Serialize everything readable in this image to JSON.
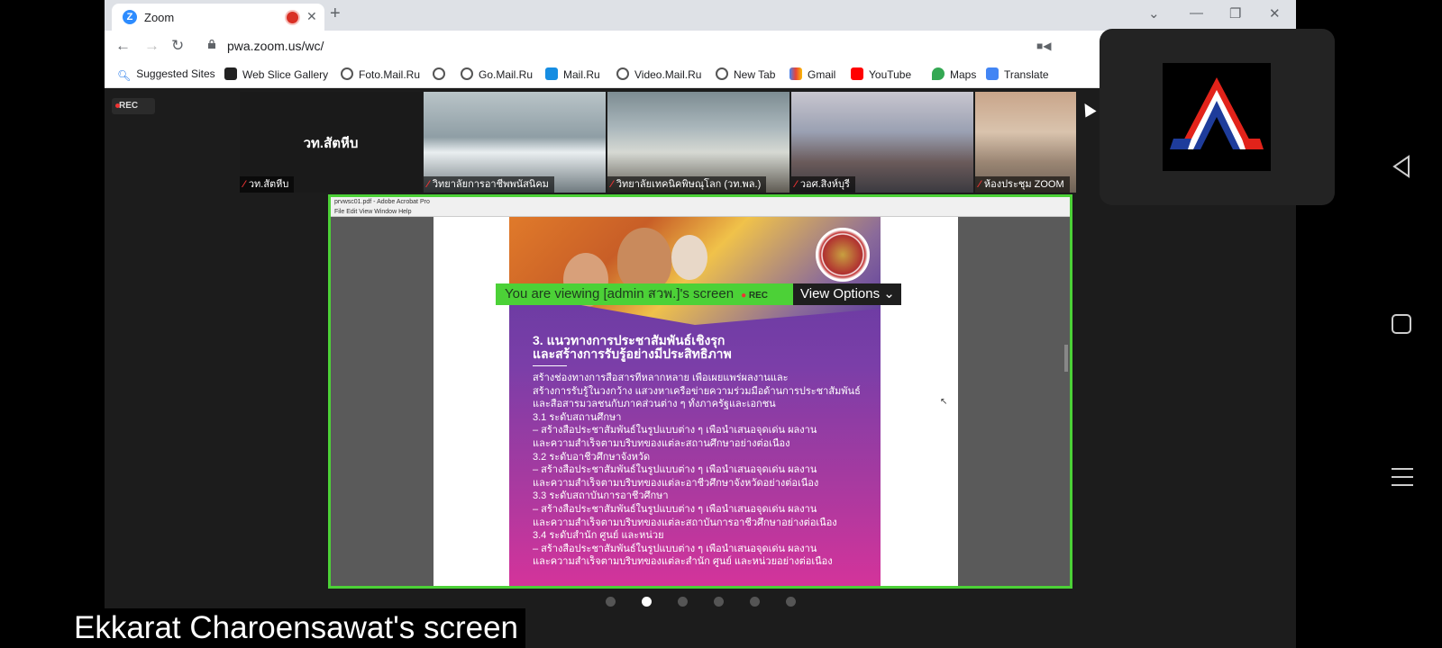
{
  "browser": {
    "tab_title": "Zoom",
    "url": "pwa.zoom.us/wc/",
    "bookmarks": [
      "Suggested Sites",
      "Web Slice Gallery",
      "Foto.Mail.Ru",
      "",
      "Go.Mail.Ru",
      "Mail.Ru",
      "Video.Mail.Ru",
      "New Tab",
      "Gmail",
      "YouTube",
      "Maps",
      "Translate"
    ]
  },
  "zoom": {
    "rec_label": "REC",
    "thumbnails": [
      {
        "name": "วท.สัตหีบ",
        "big": "วท.สัตหีบ"
      },
      {
        "name": "วิทยาลัยการอาชีพพนัสนิคม"
      },
      {
        "name": "วิทยาลัยเทคนิคพิษณุโลก (วท.พล.)"
      },
      {
        "name": "วอศ.สิงห์บุรี"
      },
      {
        "name": "ห้องประชุม ZOOM"
      }
    ],
    "viewing_text": "You are viewing [admin สวพ.]'s screen",
    "viewing_rec": "REC",
    "view_options": "View Options",
    "acrobat_title": "prvwsc01.pdf - Adobe Acrobat Pro",
    "acrobat_menu": "File  Edit  View  Window  Help",
    "doc": {
      "heading_1": "3. แนวทางการประชาสัมพันธ์เชิงรุก",
      "heading_2": "และสร้างการรับรู้อย่างมีประสิทธิภาพ",
      "lines": [
        "    สร้างช่องทางการสื่อสารที่หลากหลาย เพื่อเผยแพร่ผลงานและ",
        "สร้างการรับรู้ในวงกว้าง แสวงหาเครือข่ายความร่วมมือด้านการประชาสัมพันธ์",
        "และสื่อสารมวลชนกับภาคส่วนต่าง ๆ ทั้งภาครัฐและเอกชน",
        "3.1 ระดับสถานศึกษา",
        "    – สร้างสื่อประชาสัมพันธ์ในรูปแบบต่าง ๆ เพื่อนำเสนอจุดเด่น ผลงาน",
        "และความสำเร็จตามบริบทของแต่ละสถานศึกษาอย่างต่อเนื่อง",
        "3.2 ระดับอาชีวศึกษาจังหวัด",
        "    – สร้างสื่อประชาสัมพันธ์ในรูปแบบต่าง ๆ เพื่อนำเสนอจุดเด่น ผลงาน",
        "และความสำเร็จตามบริบทของแต่ละอาชีวศึกษาจังหวัดอย่างต่อเนื่อง",
        "3.3 ระดับสถาบันการอาชีวศึกษา",
        "    – สร้างสื่อประชาสัมพันธ์ในรูปแบบต่าง ๆ เพื่อนำเสนอจุดเด่น ผลงาน",
        "และความสำเร็จตามบริบทของแต่ละสถาบันการอาชีวศึกษาอย่างต่อเนื่อง",
        "3.4 ระดับสำนัก ศูนย์ และหน่วย",
        "    – สร้างสื่อประชาสัมพันธ์ในรูปแบบต่าง ๆ เพื่อนำเสนอจุดเด่น ผลงาน",
        "และความสำเร็จตามบริบทของแต่ละสำนัก ศูนย์ และหน่วยอย่างต่อเนื่อง"
      ]
    },
    "page_dots_count": 6,
    "page_dots_active": 1
  },
  "caption": "Ekkarat Charoensawat's screen",
  "colors": {
    "share_border": "#4cd137",
    "accent": "#2d8cff"
  }
}
